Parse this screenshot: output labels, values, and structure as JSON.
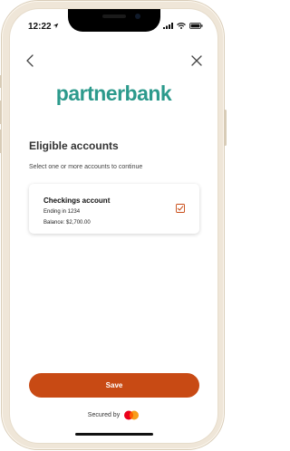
{
  "status_bar": {
    "time": "12:22"
  },
  "brand": {
    "name": "partnerbank",
    "color": "#2c9a8c"
  },
  "page": {
    "heading": "Eligible accounts",
    "subtitle": "Select one or more accounts to continue"
  },
  "accounts": [
    {
      "name": "Checkings account",
      "ending": "Ending in 1234",
      "balance_label": "Balance:",
      "balance_value": "$2,700.00",
      "selected": true
    }
  ],
  "actions": {
    "save_label": "Save",
    "save_color": "#c84a14"
  },
  "footer": {
    "secured_by": "Secured by"
  },
  "icons": {
    "location": "location-arrow-icon",
    "signal": "cellular-signal-icon",
    "wifi": "wifi-icon",
    "battery": "battery-icon",
    "back": "chevron-left-icon",
    "close": "close-icon",
    "checkbox": "checkbox-checked-icon",
    "card_brand": "mastercard-logo"
  }
}
